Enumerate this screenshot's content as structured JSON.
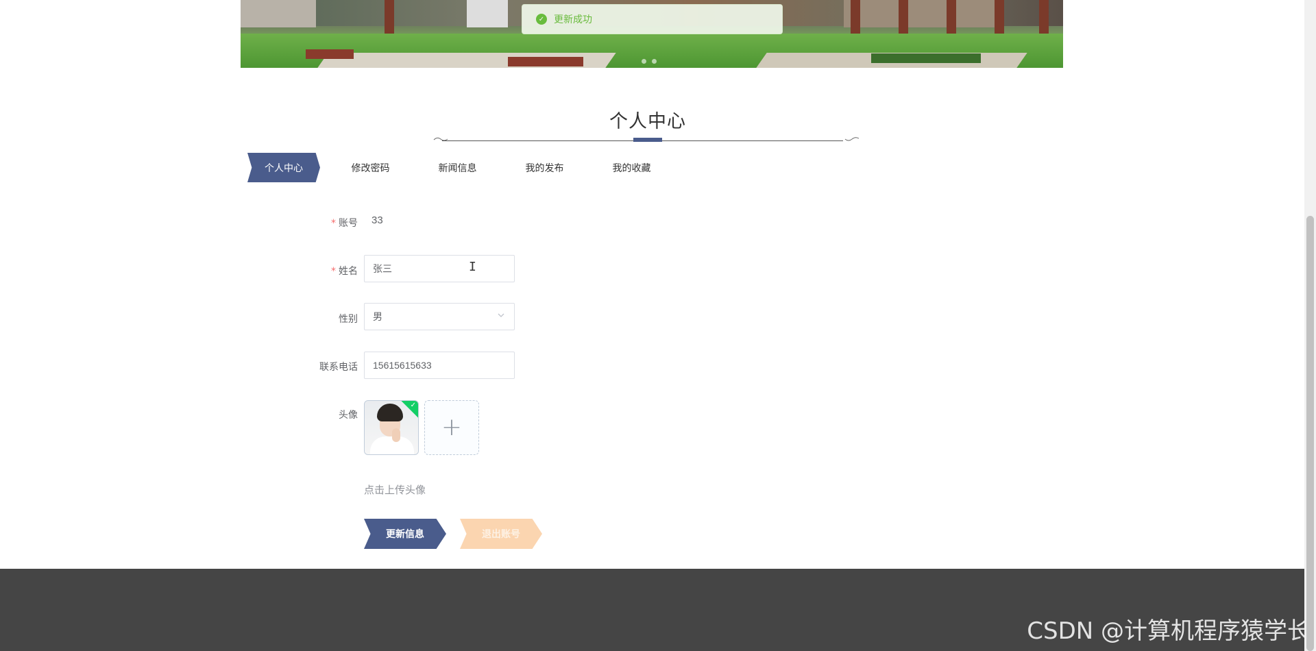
{
  "toast": {
    "message": "更新成功"
  },
  "section": {
    "title": "个人中心"
  },
  "tabs": [
    {
      "label": "个人中心",
      "active": true
    },
    {
      "label": "修改密码"
    },
    {
      "label": "新闻信息"
    },
    {
      "label": "我的发布"
    },
    {
      "label": "我的收藏"
    }
  ],
  "form": {
    "account": {
      "label": "账号",
      "value": "33",
      "required": true
    },
    "name": {
      "label": "姓名",
      "value": "张三",
      "required": true
    },
    "gender": {
      "label": "性别",
      "value": "男"
    },
    "phone": {
      "label": "联系电话",
      "value": "15615615633"
    },
    "avatar": {
      "label": "头像",
      "tip": "点击上传头像"
    },
    "required_mark": "*"
  },
  "buttons": {
    "update": "更新信息",
    "logout": "退出账号"
  },
  "watermark": "CSDN @计算机程序猿学长",
  "colors": {
    "primary": "#4a5c8c",
    "secondary": "#fbd5b0",
    "success": "#67c23a",
    "footer": "#454545"
  }
}
